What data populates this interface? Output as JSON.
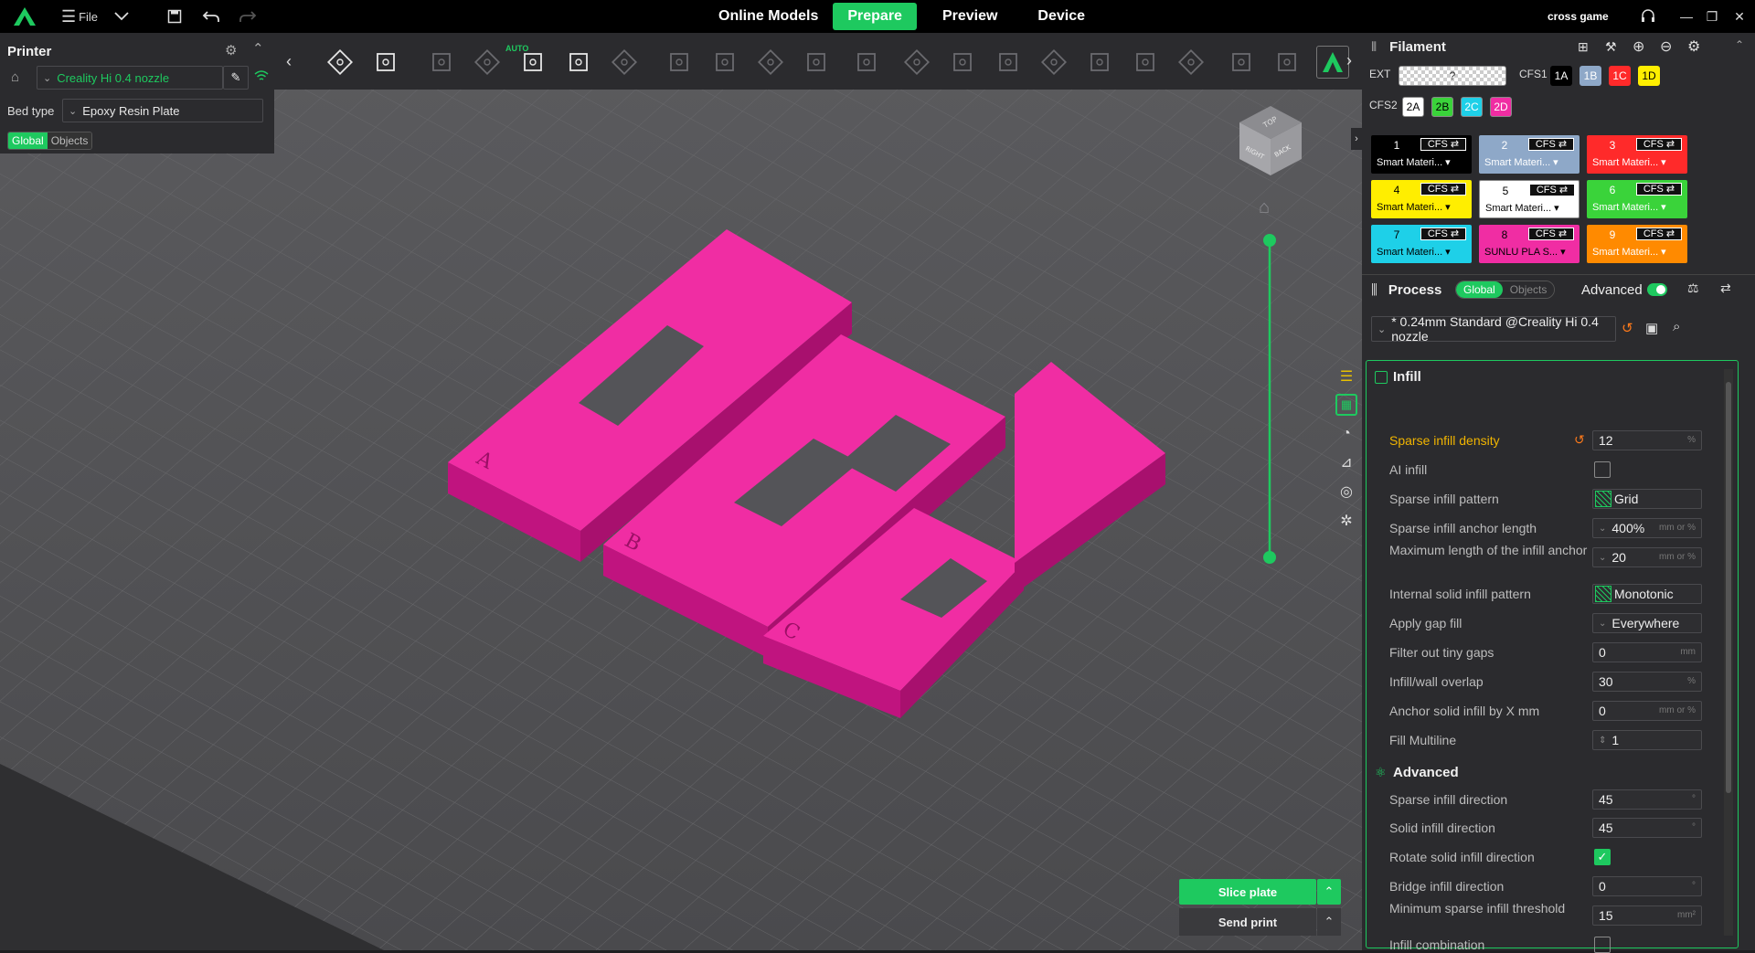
{
  "topbar": {
    "file_label": "File",
    "nav": [
      "Online Models",
      "Prepare",
      "Preview",
      "Device"
    ],
    "active_tab": "Prepare",
    "account": "cross game",
    "accent": "#1ec95f"
  },
  "printer": {
    "title": "Printer",
    "printer_name": "Creality Hi 0.4 nozzle",
    "bed_type_label": "Bed type",
    "bed_type": "Epoxy Resin Plate",
    "scope": [
      "Global",
      "Objects"
    ]
  },
  "toolbar": {
    "auto_label": "AUTO",
    "icons": [
      "add-cube-icon",
      "plate-grid-icon",
      "orient-icon",
      "arrange-icon",
      "auto-orient-icon",
      "layout-icon",
      "support-icon",
      "split-icon",
      "move-icon",
      "scale-icon",
      "rotate-icon",
      "cut-icon",
      "hollow-icon",
      "boolean-icon",
      "measure-icon",
      "assembly-icon",
      "text-icon",
      "seam-icon",
      "paint-icon",
      "variable-layer-icon",
      "fuzzy-skin-icon",
      "brim-icon",
      "font-icon"
    ]
  },
  "scene": {
    "model_color": "#f02da3",
    "letters": [
      "A",
      "B",
      "C"
    ],
    "cube_faces": [
      "TOP",
      "RIGHT",
      "BACK"
    ]
  },
  "actions": {
    "slice_label": "Slice plate",
    "send_label": "Send print"
  },
  "filament": {
    "title": "Filament",
    "ext_label": "EXT",
    "ext_value": "?",
    "cfs1_label": "CFS1",
    "cfs1": [
      {
        "id": "1A",
        "color": "#000000",
        "text": "#ffffff"
      },
      {
        "id": "1B",
        "color": "#8ea8c8",
        "text": "#ffffff"
      },
      {
        "id": "1C",
        "color": "#ff2a2a",
        "text": "#ffffff"
      },
      {
        "id": "1D",
        "color": "#ffee00",
        "text": "#000000"
      }
    ],
    "cfs2_label": "CFS2",
    "cfs2": [
      {
        "id": "2A",
        "color": "#ffffff",
        "text": "#000000"
      },
      {
        "id": "2B",
        "color": "#3ad33a",
        "text": "#000000"
      },
      {
        "id": "2C",
        "color": "#1ed0e8",
        "text": "#ffffff"
      },
      {
        "id": "2D",
        "color": "#f02da3",
        "text": "#ffffff"
      }
    ],
    "cards": [
      {
        "num": "1",
        "cfs": "CFS ⇄",
        "mat": "Smart Materi...",
        "color": "#000000",
        "text": "#ffffff"
      },
      {
        "num": "2",
        "cfs": "CFS ⇄",
        "mat": "Smart Materi...",
        "color": "#8ea8c8",
        "text": "#ffffff"
      },
      {
        "num": "3",
        "cfs": "CFS ⇄",
        "mat": "Smart Materi...",
        "color": "#ff2a2a",
        "text": "#ffffff"
      },
      {
        "num": "4",
        "cfs": "CFS ⇄",
        "mat": "Smart Materi...",
        "color": "#ffee00",
        "text": "#000000"
      },
      {
        "num": "5",
        "cfs": "CFS ⇄",
        "mat": "Smart Materi...",
        "color": "#ffffff",
        "text": "#000000"
      },
      {
        "num": "6",
        "cfs": "CFS ⇄",
        "mat": "Smart Materi...",
        "color": "#3ad33a",
        "text": "#ffffff"
      },
      {
        "num": "7",
        "cfs": "CFS ⇄",
        "mat": "Smart Materi...",
        "color": "#1ed0e8",
        "text": "#000000"
      },
      {
        "num": "8",
        "cfs": "CFS ⇄",
        "mat": "SUNLU PLA S...",
        "color": "#f02da3",
        "text": "#000000"
      },
      {
        "num": "9",
        "cfs": "CFS ⇄",
        "mat": "Smart Materi...",
        "color": "#ff8a00",
        "text": "#ffffff"
      }
    ]
  },
  "process": {
    "title": "Process",
    "scope": [
      "Global",
      "Objects"
    ],
    "advanced_label": "Advanced",
    "preset": "* 0.24mm Standard @Creality Hi 0.4 nozzle",
    "infill_section": "Infill",
    "advanced_section": "Advanced",
    "params": [
      {
        "label": "Sparse infill density",
        "value": "12",
        "unit": "%",
        "type": "num",
        "modified": true
      },
      {
        "label": "AI infill",
        "type": "check",
        "checked": false
      },
      {
        "label": "Sparse infill pattern",
        "value": "Grid",
        "type": "pattern"
      },
      {
        "label": "Sparse infill anchor length",
        "value": "400%",
        "unit": "mm or %",
        "type": "combo"
      },
      {
        "label": "Maximum length of the infill anchor",
        "value": "20",
        "unit": "mm or %",
        "type": "combo"
      },
      {
        "label": "Internal solid infill pattern",
        "value": "Monotonic",
        "type": "pattern"
      },
      {
        "label": "Apply gap fill",
        "value": "Everywhere",
        "type": "select"
      },
      {
        "label": "Filter out tiny gaps",
        "value": "0",
        "unit": "mm",
        "type": "num"
      },
      {
        "label": "Infill/wall overlap",
        "value": "30",
        "unit": "%",
        "type": "num"
      },
      {
        "label": "Anchor solid infill by X mm",
        "value": "0",
        "unit": "mm or %",
        "type": "num"
      },
      {
        "label": "Fill Multiline",
        "value": "1",
        "type": "spin"
      }
    ],
    "adv_params": [
      {
        "label": "Sparse infill direction",
        "value": "45",
        "unit": "°",
        "type": "num"
      },
      {
        "label": "Solid infill direction",
        "value": "45",
        "unit": "°",
        "type": "num"
      },
      {
        "label": "Rotate solid infill direction",
        "type": "check",
        "checked": true
      },
      {
        "label": "Bridge infill direction",
        "value": "0",
        "unit": "°",
        "type": "num"
      },
      {
        "label": "Minimum sparse infill threshold",
        "value": "15",
        "unit": "mm²",
        "type": "num"
      },
      {
        "label": "Infill combination",
        "type": "check",
        "checked": false
      }
    ]
  }
}
